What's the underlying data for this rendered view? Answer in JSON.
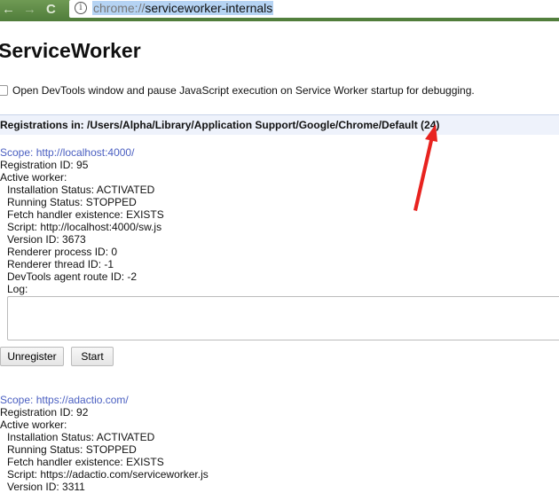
{
  "browser": {
    "url_scheme": "chrome://",
    "url_path": "serviceworker-internals",
    "back_icon": "←",
    "forward_icon": "→",
    "reload_icon": "C",
    "info_icon": "i"
  },
  "page": {
    "title": "ServiceWorker",
    "debug_checkbox_label": "Open DevTools window and pause JavaScript execution on Service Worker startup for debugging.",
    "debug_checkbox_checked": false,
    "registrations_header": "Registrations in: /Users/Alpha/Library/Application Support/Google/Chrome/Default (24)"
  },
  "registrations": [
    {
      "scope": "Scope: http://localhost:4000/",
      "registration_id": "Registration ID: 95",
      "active_worker": "Active worker:",
      "installation_status": "Installation Status: ACTIVATED",
      "running_status": "Running Status: STOPPED",
      "fetch_handler": "Fetch handler existence: EXISTS",
      "script": "Script: http://localhost:4000/sw.js",
      "version_id": "Version ID: 3673",
      "renderer_process": "Renderer process ID: 0",
      "renderer_thread": "Renderer thread ID: -1",
      "devtools_route": "DevTools agent route ID: -2",
      "log_label": "Log:",
      "unregister_label": "Unregister",
      "start_label": "Start"
    },
    {
      "scope": "Scope: https://adactio.com/",
      "registration_id": "Registration ID: 92",
      "active_worker": "Active worker:",
      "installation_status": "Installation Status: ACTIVATED",
      "running_status": "Running Status: STOPPED",
      "fetch_handler": "Fetch handler existence: EXISTS",
      "script": "Script: https://adactio.com/serviceworker.js",
      "version_id": "Version ID: 3311"
    }
  ],
  "annotation": {
    "color": "#e8231f"
  }
}
